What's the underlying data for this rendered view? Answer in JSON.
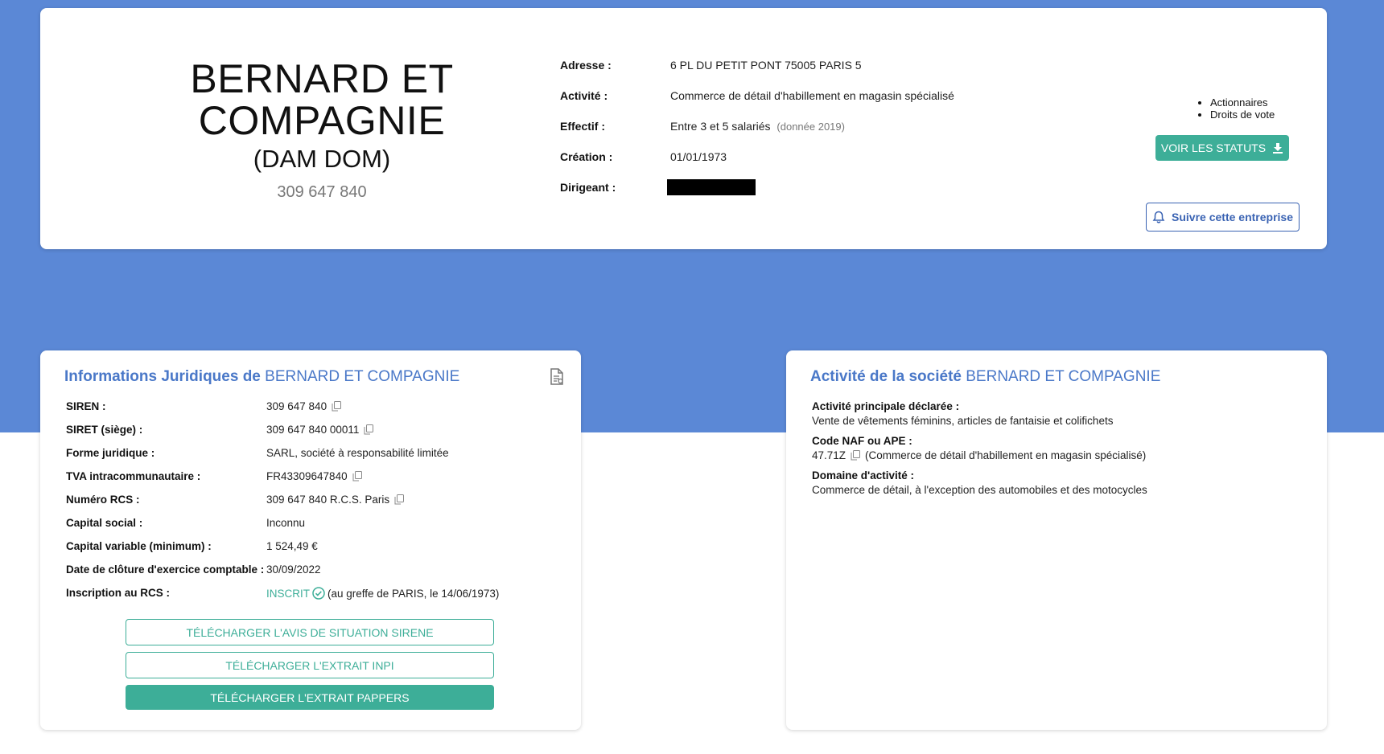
{
  "header": {
    "company_name": "BERNARD ET COMPAGNIE",
    "alias": "(DAM DOM)",
    "siren": "309 647 840",
    "info": [
      {
        "label": "Adresse :",
        "value": "6 PL DU PETIT PONT 75005 PARIS 5"
      },
      {
        "label": "Activité :",
        "value": "Commerce de détail d'habillement en magasin spécialisé"
      },
      {
        "label": "Effectif :",
        "value": "Entre 3 et 5 salariés",
        "note": "(donnée 2019)"
      },
      {
        "label": "Création :",
        "value": "01/01/1973"
      },
      {
        "label": "Dirigeant :",
        "value": ""
      }
    ],
    "bullets": [
      "Actionnaires",
      "Droits de vote"
    ],
    "statuts_button": "VOIR LES STATUTS",
    "follow_button": "Suivre cette entreprise"
  },
  "legal": {
    "title_prefix": "Informations Juridiques de",
    "title_company": "BERNARD ET COMPAGNIE",
    "rows": [
      {
        "label": "SIREN :",
        "value": "309 647 840",
        "copy": true
      },
      {
        "label": "SIRET (siège) :",
        "value": "309 647 840 00011",
        "copy": true
      },
      {
        "label": "Forme juridique :",
        "value": "SARL, société à responsabilité limitée",
        "copy": false
      },
      {
        "label": "TVA intracommunautaire :",
        "value": "FR43309647840",
        "copy": true
      },
      {
        "label": "Numéro RCS :",
        "value": "309 647 840 R.C.S. Paris",
        "copy": true
      },
      {
        "label": "Capital social :",
        "value": "Inconnu",
        "copy": false
      },
      {
        "label": "Capital variable (minimum) :",
        "value": "1 524,49 €",
        "copy": false
      },
      {
        "label": "Date de clôture d'exercice comptable :",
        "value": "30/09/2022",
        "copy": false
      },
      {
        "label": "Inscription au RCS :",
        "status": "INSCRIT",
        "value": "(au greffe de PARIS, le 14/06/1973)",
        "copy": false
      }
    ],
    "buttons": [
      "TÉLÉCHARGER L'AVIS DE SITUATION SIRENE",
      "TÉLÉCHARGER L'EXTRAIT INPI",
      "TÉLÉCHARGER L'EXTRAIT PAPPERS"
    ]
  },
  "activity": {
    "title_prefix": "Activité de la société",
    "title_company": "BERNARD ET COMPAGNIE",
    "rows": [
      {
        "label": "Activité principale déclarée :",
        "value": "Vente de vêtements féminins, articles de fantaisie et colifichets"
      },
      {
        "label": "Code NAF ou APE :",
        "code": "47.71Z",
        "value": "(Commerce de détail d'habillement en magasin spécialisé)"
      },
      {
        "label": "Domaine d'activité :",
        "value": "Commerce de détail, à l'exception des automobiles et des motocycles"
      }
    ]
  },
  "colors": {
    "background_blue": "#5b88d6",
    "accent_green": "#3dae98",
    "title_blue": "#4a78c8",
    "follow_blue": "#3a63b3"
  },
  "icons": [
    "download-icon",
    "bell-icon",
    "document-icon",
    "copy-icon",
    "check-circle-icon"
  ]
}
